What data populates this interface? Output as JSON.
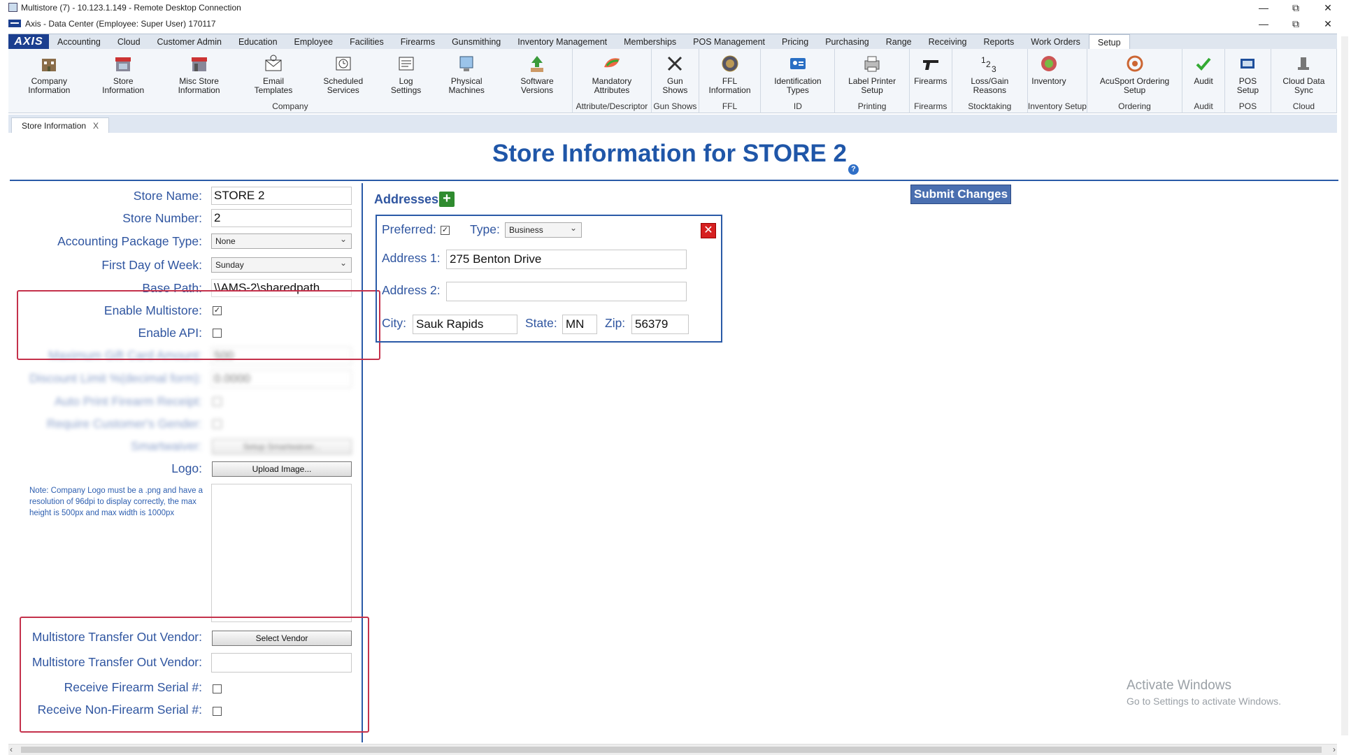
{
  "window": {
    "title": "Multistore (7) - 10.123.1.149 - Remote Desktop Connection",
    "app_title": "Axis - Data Center  (Employee: Super User) 170117"
  },
  "menu": {
    "logo": "AXIS",
    "items": [
      "Accounting",
      "Cloud",
      "Customer Admin",
      "Education",
      "Employee",
      "Facilities",
      "Firearms",
      "Gunsmithing",
      "Inventory Management",
      "Memberships",
      "POS Management",
      "Pricing",
      "Purchasing",
      "Range",
      "Receiving",
      "Reports",
      "Work Orders",
      "Setup"
    ],
    "active": "Setup"
  },
  "ribbon": [
    {
      "group": "Company",
      "items": [
        {
          "label": "Company Information",
          "icon": "company-building-icon"
        },
        {
          "label": "Store Information",
          "icon": "storefront-icon"
        },
        {
          "label": "Misc Store Information",
          "icon": "misc-store-icon"
        },
        {
          "label": "Email Templates",
          "icon": "email-envelope-icon"
        },
        {
          "label": "Scheduled Services",
          "icon": "scheduled-services-icon"
        },
        {
          "label": "Log Settings",
          "icon": "log-settings-icon"
        },
        {
          "label": "Physical Machines",
          "icon": "computer-icon"
        },
        {
          "label": "Software Versions",
          "icon": "software-download-icon"
        }
      ]
    },
    {
      "group": "Attribute/Descriptor",
      "items": [
        {
          "label": "Mandatory Attributes",
          "icon": "mandatory-attributes-icon"
        }
      ]
    },
    {
      "group": "Gun Shows",
      "items": [
        {
          "label": "Gun Shows",
          "icon": "crossed-guns-icon"
        }
      ]
    },
    {
      "group": "FFL",
      "items": [
        {
          "label": "FFL Information",
          "icon": "ffl-seal-icon"
        }
      ]
    },
    {
      "group": "ID",
      "items": [
        {
          "label": "Identification Types",
          "icon": "id-card-icon"
        }
      ]
    },
    {
      "group": "Printing",
      "items": [
        {
          "label": "Label Printer Setup",
          "icon": "label-printer-icon"
        }
      ]
    },
    {
      "group": "Firearms",
      "items": [
        {
          "label": "Firearms",
          "icon": "pistol-icon"
        }
      ]
    },
    {
      "group": "Stocktaking",
      "items": [
        {
          "label": "Loss/Gain Reasons",
          "icon": "numbers-123-icon"
        }
      ]
    },
    {
      "group": "Inventory Setup",
      "items": [
        {
          "label": "Inventory",
          "icon": "inventory-globe-icon"
        }
      ]
    },
    {
      "group": "Ordering",
      "items": [
        {
          "label": "AcuSport Ordering Setup",
          "icon": "acusport-icon"
        }
      ]
    },
    {
      "group": "Audit",
      "items": [
        {
          "label": "Audit",
          "icon": "audit-check-icon"
        }
      ]
    },
    {
      "group": "POS",
      "items": [
        {
          "label": "POS Setup",
          "icon": "pos-setup-icon"
        }
      ]
    },
    {
      "group": "Cloud",
      "items": [
        {
          "label": "Cloud Data Sync",
          "icon": "cloud-sync-icon"
        }
      ]
    }
  ],
  "doc_tab": {
    "label": "Store Information",
    "close": "X"
  },
  "page": {
    "title": "Store Information for STORE 2",
    "help": "?",
    "submit_label": "Submit Changes"
  },
  "form": {
    "store_name_label": "Store Name:",
    "store_name": "STORE 2",
    "store_number_label": "Store Number:",
    "store_number": "2",
    "accounting_label": "Accounting Package Type:",
    "accounting_value": "None",
    "first_day_label": "First Day of Week:",
    "first_day_value": "Sunday",
    "base_path_label": "Base Path:",
    "base_path": "\\\\AMS-2\\sharedpath",
    "enable_multistore_label": "Enable Multistore:",
    "enable_multistore": true,
    "enable_api_label": "Enable API:",
    "enable_api": false,
    "max_gift_label": "Maximum Gift Card Amount:",
    "max_gift": "500",
    "discount_label": "Discount Limit %(decimal form):",
    "discount": "0.0000",
    "auto_print_label": "Auto Print Firearm Receipt:",
    "require_gender_label": "Require Customer's Gender:",
    "smartwaiver_label": "Smartwaiver:",
    "smartwaiver_btn": "Setup Smartwaiver...",
    "logo_label": "Logo:",
    "upload_btn": "Upload Image...",
    "logo_note": "Note: Company Logo must be a .png and have a resolution of 96dpi to display correctly, the max height is 500px and max width is 1000px",
    "transfer_vendor_label": "Multistore Transfer Out Vendor:",
    "select_vendor_btn": "Select Vendor",
    "transfer_vendor_label2": "Multistore Transfer Out Vendor:",
    "transfer_vendor_value": "",
    "receive_firearm_label": "Receive Firearm Serial #:",
    "receive_nonfirearm_label": "Receive Non-Firearm Serial #:"
  },
  "addresses": {
    "heading": "Addresses",
    "add": "+",
    "preferred_label": "Preferred:",
    "type_label": "Type:",
    "type_value": "Business",
    "address1_label": "Address 1:",
    "address1": "275 Benton Drive",
    "address2_label": "Address 2:",
    "address2": "",
    "city_label": "City:",
    "city": "Sauk Rapids",
    "state_label": "State:",
    "state": "MN",
    "zip_label": "Zip:",
    "zip": "56379",
    "delete": "✕"
  },
  "watermark": {
    "line1": "Activate Windows",
    "line2": "Go to Settings to activate Windows."
  }
}
